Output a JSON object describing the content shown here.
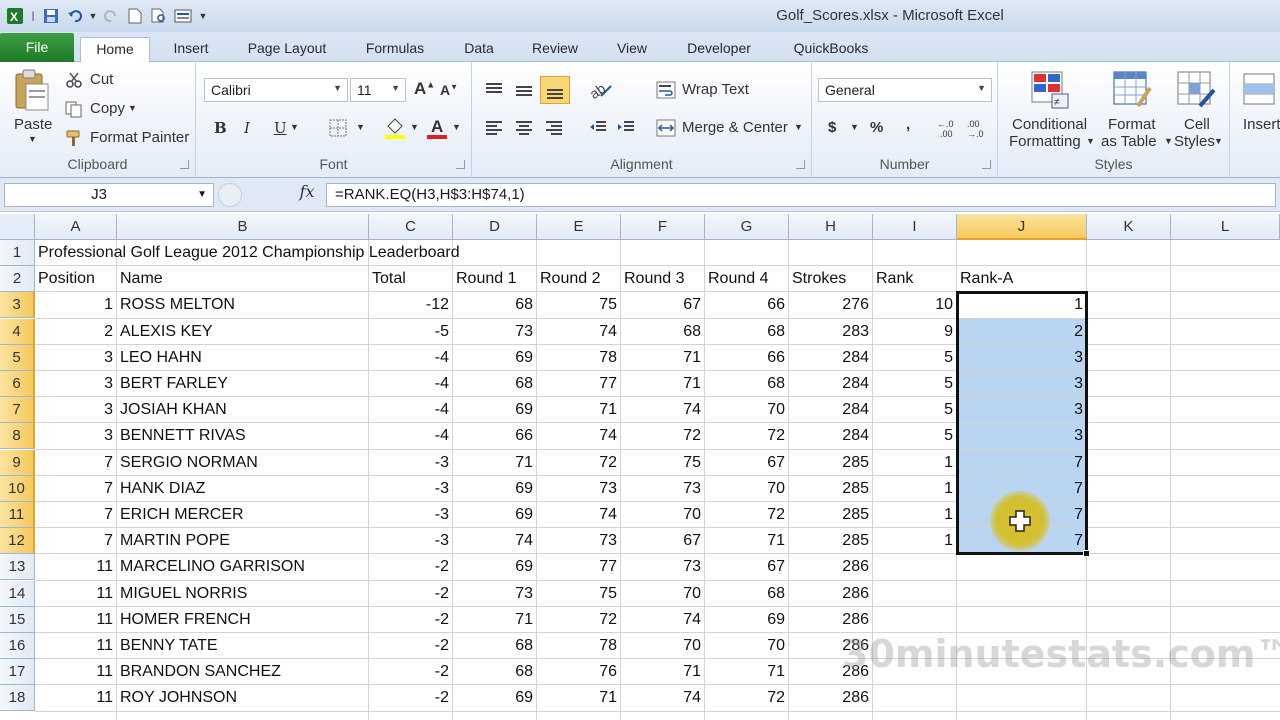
{
  "window": {
    "title": "Golf_Scores.xlsx - Microsoft Excel"
  },
  "ribbon": {
    "tabs": [
      "File",
      "Home",
      "Insert",
      "Page Layout",
      "Formulas",
      "Data",
      "Review",
      "View",
      "Developer",
      "QuickBooks"
    ],
    "active_tab": "Home",
    "clipboard": {
      "paste": "Paste",
      "cut": "Cut",
      "copy": "Copy",
      "format_painter": "Format Painter",
      "label": "Clipboard"
    },
    "font": {
      "name": "Calibri",
      "size": "11",
      "bold": "B",
      "italic": "I",
      "underline": "U",
      "label": "Font"
    },
    "alignment": {
      "wrap_text": "Wrap Text",
      "merge_center": "Merge & Center",
      "label": "Alignment"
    },
    "number": {
      "format": "General",
      "currency": "$",
      "percent": "%",
      "comma": ",",
      "label": "Number"
    },
    "styles": {
      "conditional_1": "Conditional",
      "conditional_2": "Formatting",
      "format_table_1": "Format",
      "format_table_2": "as Table",
      "cell_styles_1": "Cell",
      "cell_styles_2": "Styles",
      "label": "Styles"
    },
    "cells": {
      "insert": "Insert"
    }
  },
  "formula_bar": {
    "name_box": "J3",
    "fx": "fx",
    "formula": "=RANK.EQ(H3,H$3:H$74,1)"
  },
  "sheet": {
    "columns": [
      "A",
      "B",
      "C",
      "D",
      "E",
      "F",
      "G",
      "H",
      "I",
      "J",
      "K",
      "L"
    ],
    "selected_column": "J",
    "rows": [
      "1",
      "2",
      "3",
      "4",
      "5",
      "6",
      "7",
      "8",
      "9",
      "10",
      "11",
      "12",
      "13",
      "14",
      "15",
      "16",
      "17",
      "18"
    ],
    "title": "Professional Golf League 2012 Championship Leaderboard",
    "headers": [
      "Position",
      "Name",
      "Total",
      "Round 1",
      "Round 2",
      "Round 3",
      "Round 4",
      "Strokes",
      "Rank",
      "Rank-A"
    ],
    "data": [
      [
        "1",
        "ROSS MELTON",
        "-12",
        "68",
        "75",
        "67",
        "66",
        "276",
        "10",
        "1"
      ],
      [
        "2",
        "ALEXIS KEY",
        "-5",
        "73",
        "74",
        "68",
        "68",
        "283",
        "9",
        "2"
      ],
      [
        "3",
        "LEO HAHN",
        "-4",
        "69",
        "78",
        "71",
        "66",
        "284",
        "5",
        "3"
      ],
      [
        "3",
        "BERT FARLEY",
        "-4",
        "68",
        "77",
        "71",
        "68",
        "284",
        "5",
        "3"
      ],
      [
        "3",
        "JOSIAH KHAN",
        "-4",
        "69",
        "71",
        "74",
        "70",
        "284",
        "5",
        "3"
      ],
      [
        "3",
        "BENNETT RIVAS",
        "-4",
        "66",
        "74",
        "72",
        "72",
        "284",
        "5",
        "3"
      ],
      [
        "7",
        "SERGIO NORMAN",
        "-3",
        "71",
        "72",
        "75",
        "67",
        "285",
        "1",
        "7"
      ],
      [
        "7",
        "HANK DIAZ",
        "-3",
        "69",
        "73",
        "73",
        "70",
        "285",
        "1",
        "7"
      ],
      [
        "7",
        "ERICH MERCER",
        "-3",
        "69",
        "74",
        "70",
        "72",
        "285",
        "1",
        "7"
      ],
      [
        "7",
        "MARTIN POPE",
        "-3",
        "74",
        "73",
        "67",
        "71",
        "285",
        "1",
        "7"
      ],
      [
        "11",
        "MARCELINO GARRISON",
        "-2",
        "69",
        "77",
        "73",
        "67",
        "286",
        "",
        ""
      ],
      [
        "11",
        "MIGUEL NORRIS",
        "-2",
        "73",
        "75",
        "70",
        "68",
        "286",
        "",
        ""
      ],
      [
        "11",
        "HOMER FRENCH",
        "-2",
        "71",
        "72",
        "74",
        "69",
        "286",
        "",
        ""
      ],
      [
        "11",
        "BENNY TATE",
        "-2",
        "68",
        "78",
        "70",
        "70",
        "286",
        "",
        ""
      ],
      [
        "11",
        "BRANDON SANCHEZ",
        "-2",
        "68",
        "76",
        "71",
        "71",
        "286",
        "",
        ""
      ],
      [
        "11",
        "ROY JOHNSON",
        "-2",
        "69",
        "71",
        "74",
        "72",
        "286",
        "",
        ""
      ]
    ]
  },
  "watermark": "30minutestats.com™",
  "colors": {
    "file_tab": "#2a8a33",
    "selection_fill": "#bad5f1",
    "header_selected": "#f5c95c",
    "cursor_halo": "#d8be14"
  }
}
